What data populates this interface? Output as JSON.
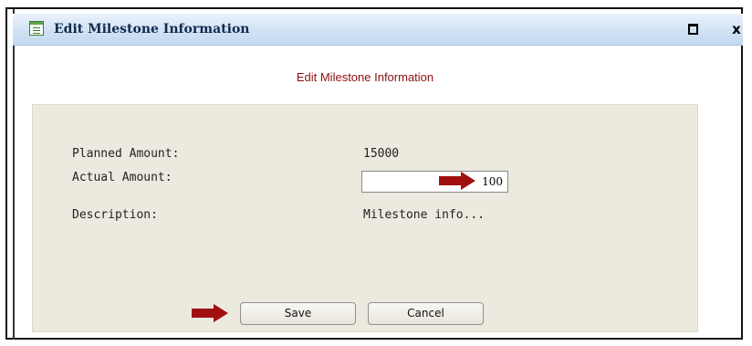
{
  "window": {
    "title": "Edit Milestone Information",
    "icon": "form-document-icon",
    "controls": {
      "maximize_icon": "maximize-icon",
      "close_label": "x"
    }
  },
  "form": {
    "heading": "Edit Milestone Information",
    "planned_amount": {
      "label": "Planned Amount:",
      "value": "15000"
    },
    "actual_amount": {
      "label": "Actual Amount:",
      "value": "100"
    },
    "description": {
      "label": "Description:",
      "value": "Milestone info..."
    }
  },
  "buttons": {
    "save_label": "Save",
    "cancel_label": "Cancel"
  },
  "annotations": {
    "arrow_color": "#a01010",
    "arrows": [
      "arrow-right-icon",
      "arrow-right-icon"
    ]
  },
  "colors": {
    "heading": "#8b1010",
    "panel_background": "#ece9df",
    "titlebar": "#d2e2f4"
  }
}
